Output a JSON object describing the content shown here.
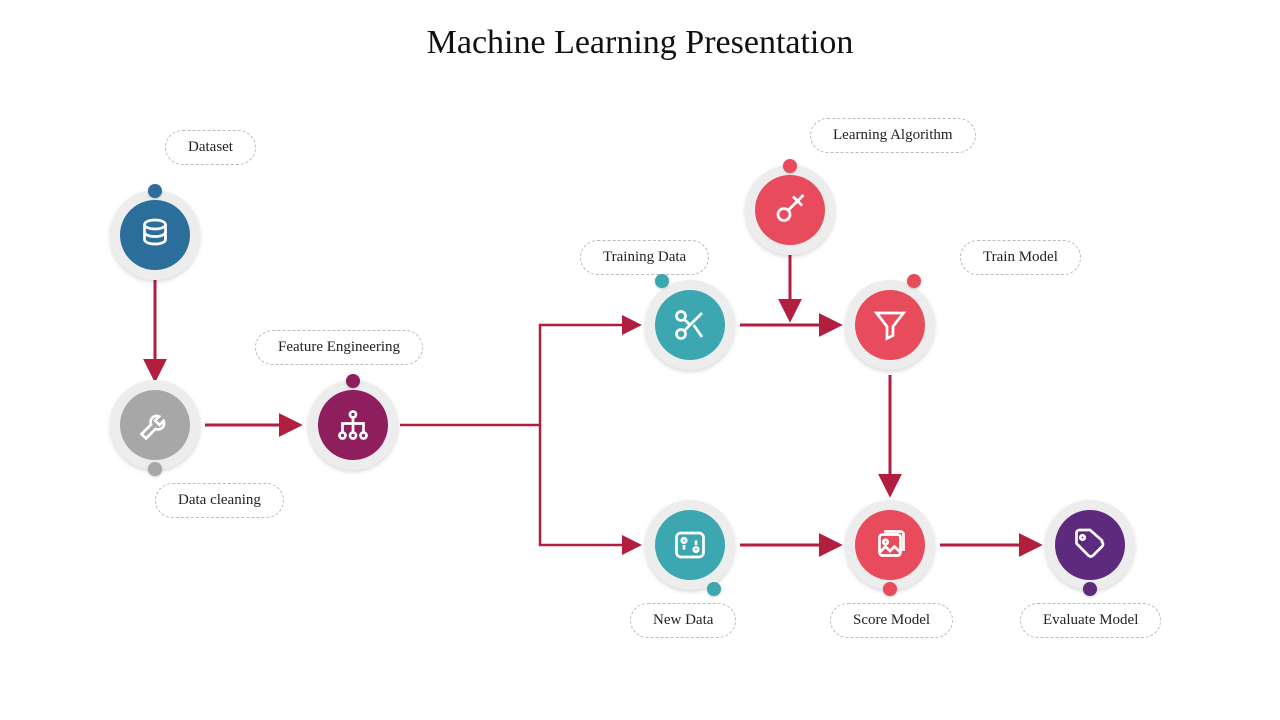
{
  "title": "Machine Learning Presentation",
  "colors": {
    "blue": "#2C6E9B",
    "gray": "#A7A7A7",
    "magenta": "#8E1E5D",
    "teal": "#3CA7B0",
    "red": "#E84C5C",
    "purple": "#5E2A7E",
    "arrow": "#B21E3D"
  },
  "nodes": {
    "dataset": {
      "label": "Dataset",
      "icon": "database",
      "color_key": "blue",
      "dot": "top"
    },
    "data_cleaning": {
      "label": "Data cleaning",
      "icon": "wrench",
      "color_key": "gray",
      "dot": "bottom"
    },
    "feature_engineering": {
      "label": "Feature Engineering",
      "icon": "hierarchy",
      "color_key": "magenta",
      "dot": "top"
    },
    "training_data": {
      "label": "Training Data",
      "icon": "scissors",
      "color_key": "teal",
      "dot": "top"
    },
    "new_data": {
      "label": "New Data",
      "icon": "switch",
      "color_key": "teal",
      "dot": "bottom"
    },
    "learning_algorithm": {
      "label": "Learning Algorithm",
      "icon": "key",
      "color_key": "red",
      "dot": "top"
    },
    "train_model": {
      "label": "Train Model",
      "icon": "funnel",
      "color_key": "red",
      "dot": "top"
    },
    "score_model": {
      "label": "Score Model",
      "icon": "image",
      "color_key": "red",
      "dot": "bottom"
    },
    "evaluate_model": {
      "label": "Evaluate Model",
      "icon": "tags",
      "color_key": "purple",
      "dot": "bottom"
    }
  }
}
